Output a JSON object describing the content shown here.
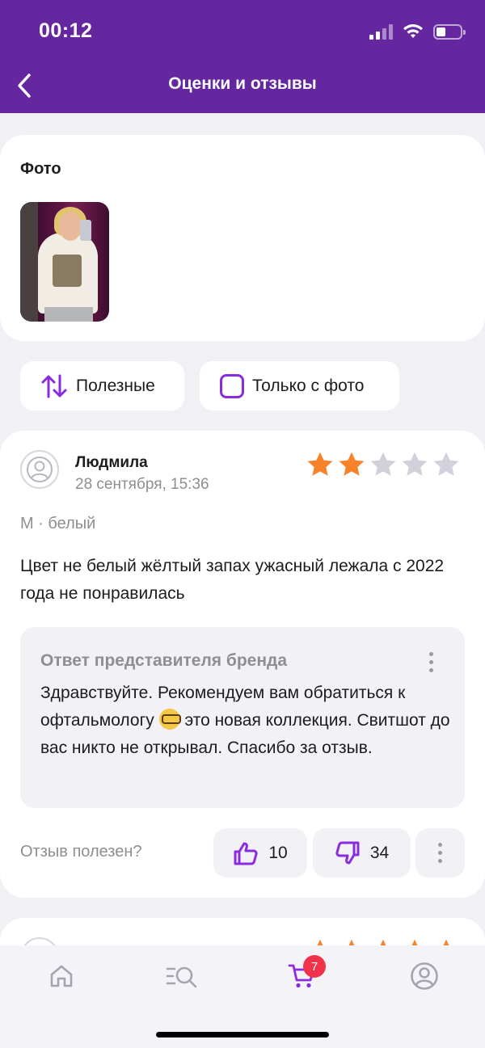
{
  "status_bar": {
    "time": "00:12"
  },
  "header": {
    "title": "Оценки и отзывы",
    "back_icon": "chevron-left-icon"
  },
  "photos": {
    "title": "Фото",
    "count_shown": 1
  },
  "filters": {
    "sort_label": "Полезные",
    "sort_icon": "sort-arrows-icon",
    "photo_only_label": "Только с фото",
    "photo_only_checked": false
  },
  "review": {
    "author": "Людмила",
    "date": "28 сентября, 15:36",
    "rating": 2,
    "rating_max": 5,
    "variant": "M · белый",
    "text": "Цвет не белый жёлтый запах ужасный лежала с 2022 года не понравилась",
    "brand_reply": {
      "title": "Ответ представителя бренда",
      "text_before_emoji": "Здравствуйте. Рекомендуем вам обратиться к офтальмологу",
      "emoji": "nerd-face-emoji",
      "text_after_emoji": "это новая коллекция. Свитшот до вас никто не открывал. Спасибо за отзыв."
    },
    "helpful_label": "Отзыв полезен?",
    "likes": "10",
    "dislikes": "34"
  },
  "next_review": {
    "rating": 5
  },
  "bottom_nav": {
    "items": [
      "home-icon",
      "catalog-search-icon",
      "cart-icon",
      "profile-icon"
    ],
    "cart_badge": "7",
    "active": "cart"
  },
  "colors": {
    "brand": "#6527a0",
    "accent": "#8a2be2",
    "star_filled": "#f7822a",
    "star_empty": "#d2d0da",
    "badge": "#f0324b"
  }
}
